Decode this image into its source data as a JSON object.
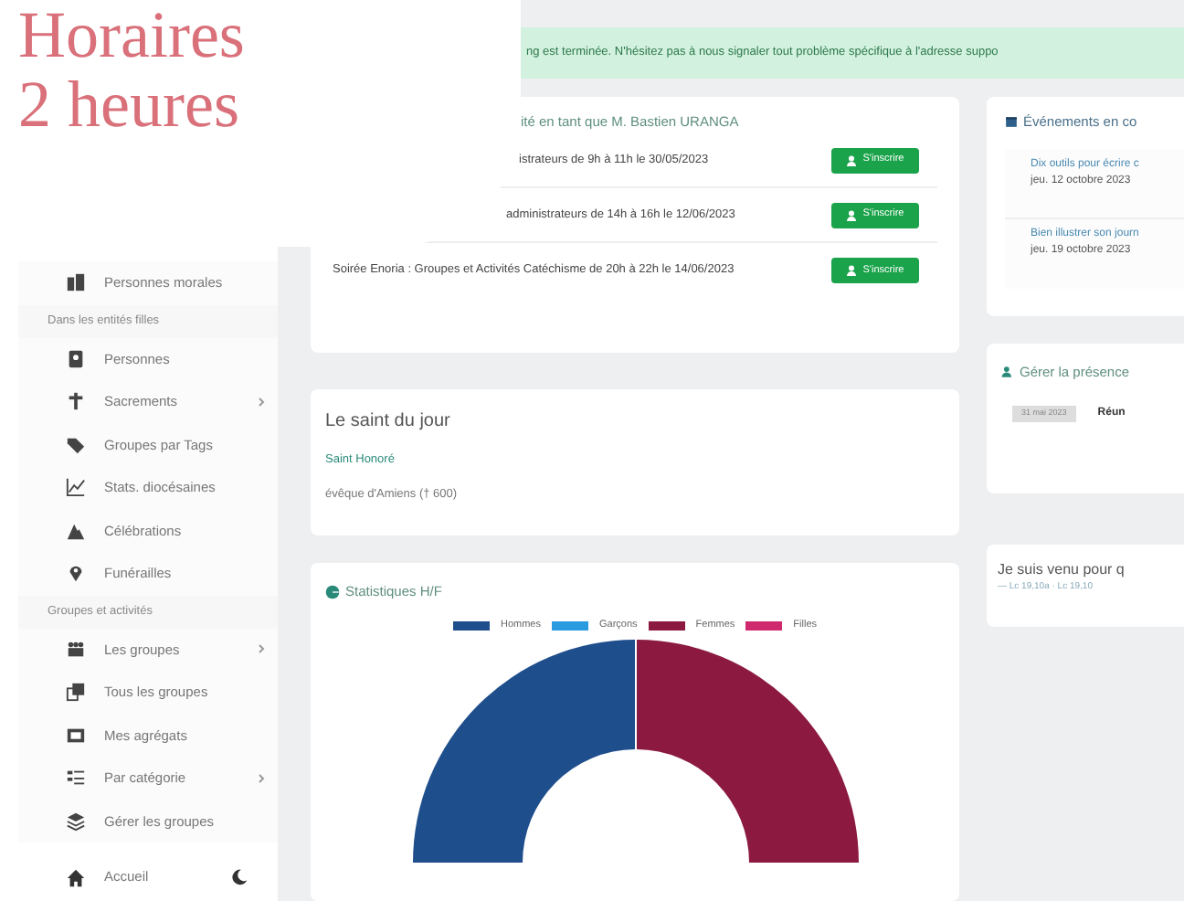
{
  "overlay": {
    "lines": [
      "Horaires",
      "2 heures"
    ]
  },
  "alert": {
    "text": "ng est terminée. N'hésitez pas à nous signaler tout problème spécifique à l'adresse suppo"
  },
  "sidebar": {
    "items": [
      {
        "kind": "item",
        "label": "Personnes morales",
        "expandable": false
      },
      {
        "kind": "section",
        "label": "Dans les entités filles"
      },
      {
        "kind": "item",
        "label": "Personnes",
        "expandable": false
      },
      {
        "kind": "item",
        "label": "Sacrements",
        "expandable": true
      },
      {
        "kind": "item",
        "label": "Groupes par Tags",
        "expandable": false
      },
      {
        "kind": "item",
        "label": "Stats. diocésaines",
        "expandable": false
      },
      {
        "kind": "item",
        "label": "Célébrations",
        "expandable": false
      },
      {
        "kind": "item",
        "label": "Funérailles",
        "expandable": false
      },
      {
        "kind": "section",
        "label": "Groupes et activités"
      },
      {
        "kind": "item",
        "label": "Les groupes",
        "expandable": true
      },
      {
        "kind": "item",
        "label": "Tous les groupes",
        "expandable": false
      },
      {
        "kind": "item",
        "label": "Mes agrégats",
        "expandable": false
      },
      {
        "kind": "item",
        "label": "Par catégorie",
        "expandable": true
      },
      {
        "kind": "item",
        "label": "Gérer les groupes",
        "expandable": false
      }
    ],
    "footer": {
      "label": "Accueil"
    }
  },
  "registrations": {
    "title": "ité en tant que M. Bastien URANGA",
    "rows": [
      {
        "text": "istrateurs de 9h à 11h le 30/05/2023",
        "button": "S'inscrire"
      },
      {
        "text": "administrateurs de 14h à 16h le 12/06/2023",
        "button": "S'inscrire"
      },
      {
        "text": "Soirée Enoria : Groupes et Activités Catéchisme de 20h à 22h le 14/06/2023",
        "button": "S'inscrire"
      }
    ]
  },
  "saint": {
    "heading": "Le saint du jour",
    "name": "Saint Honoré",
    "description": "évêque d'Amiens († 600)"
  },
  "stats": {
    "title": "Statistiques H/F",
    "legend": [
      {
        "label": "Hommes",
        "color": "#1f4e8c"
      },
      {
        "label": "Garçons",
        "color": "#2a9be0"
      },
      {
        "label": "Femmes",
        "color": "#8c1a40"
      },
      {
        "label": "Filles",
        "color": "#d02a6e"
      }
    ]
  },
  "events": {
    "title": "Événements en co",
    "items": [
      {
        "title": "Dix outils pour écrire c",
        "date": "jeu. 12 octobre 2023"
      },
      {
        "title": "Bien illustrer son journ",
        "date": "jeu. 19 octobre 2023"
      }
    ]
  },
  "attendance": {
    "title": "Gérer la présence",
    "date": "31 mai 2023",
    "label": "Réun"
  },
  "quote": {
    "text": "Je suis venu pour q",
    "source": "— Lc 19,10a · Lc 19,10"
  }
}
